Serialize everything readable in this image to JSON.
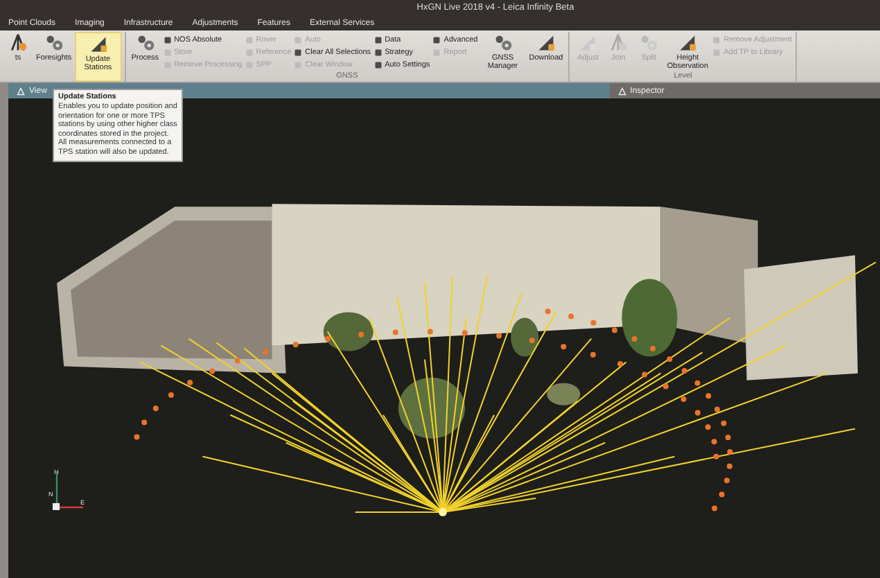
{
  "window": {
    "title": "HxGN Live 2018 v4 - Leica Infinity Beta"
  },
  "menu_tabs": [
    "Point Clouds",
    "Imaging",
    "Infrastructure",
    "Adjustments",
    "Features",
    "External Services"
  ],
  "ribbon": {
    "groups": [
      {
        "items": [
          {
            "kind": "large",
            "label": "ts",
            "selected": false,
            "disabled": false
          },
          {
            "kind": "large",
            "label": "Foresights",
            "selected": false,
            "disabled": false
          },
          {
            "kind": "large",
            "label": "Update Stations",
            "selected": true,
            "disabled": false
          }
        ]
      },
      {
        "label": "GNSS",
        "items": [
          {
            "kind": "large",
            "label": "Process",
            "selected": false,
            "disabled": false
          },
          {
            "kind": "stack",
            "entries": [
              {
                "label": "NOS Absolute",
                "disabled": false
              },
              {
                "label": "Store",
                "disabled": true
              },
              {
                "label": "Remove Processing",
                "disabled": true
              }
            ]
          },
          {
            "kind": "stack",
            "entries": [
              {
                "label": "Rover",
                "disabled": true
              },
              {
                "label": "Reference",
                "disabled": true
              },
              {
                "label": "SPP",
                "disabled": true
              }
            ]
          },
          {
            "kind": "stack",
            "entries": [
              {
                "label": "Auto",
                "disabled": true
              },
              {
                "label": "Clear All Selections",
                "disabled": false
              },
              {
                "label": "Clear Window",
                "disabled": true
              }
            ]
          },
          {
            "kind": "stack",
            "entries": [
              {
                "label": "Data",
                "disabled": false
              },
              {
                "label": "Strategy",
                "disabled": false
              },
              {
                "label": "Auto Settings",
                "disabled": false
              }
            ]
          },
          {
            "kind": "stack",
            "entries": [
              {
                "label": "Advanced",
                "disabled": false
              },
              {
                "label": "Report",
                "disabled": true
              }
            ]
          },
          {
            "kind": "large",
            "label": "GNSS Manager",
            "selected": false,
            "disabled": false
          },
          {
            "kind": "large",
            "label": "Download",
            "selected": false,
            "disabled": false
          }
        ]
      },
      {
        "label": "Level",
        "items": [
          {
            "kind": "large",
            "label": "Adjust",
            "selected": false,
            "disabled": true
          },
          {
            "kind": "large",
            "label": "Join",
            "selected": false,
            "disabled": true
          },
          {
            "kind": "large",
            "label": "Split",
            "selected": false,
            "disabled": true
          },
          {
            "kind": "large",
            "label": "Height Observation",
            "selected": false,
            "disabled": false
          },
          {
            "kind": "stack",
            "entries": [
              {
                "label": "Remove Adjustment",
                "disabled": true
              },
              {
                "label": "Add TP to Library",
                "disabled": true
              }
            ]
          }
        ]
      }
    ]
  },
  "panel_tabs": [
    {
      "label": "View",
      "selected": true
    },
    {
      "label": "Inspector",
      "selected": false
    }
  ],
  "tooltip": {
    "title": "Update Stations",
    "paragraphs": [
      "Enables you to update position and orientation for one or more TPS stations by using other higher class coordinates stored in the project.",
      "All measurements connected to a TPS station will also be updated."
    ]
  },
  "axis_labels": [
    "H",
    "N",
    "E"
  ]
}
